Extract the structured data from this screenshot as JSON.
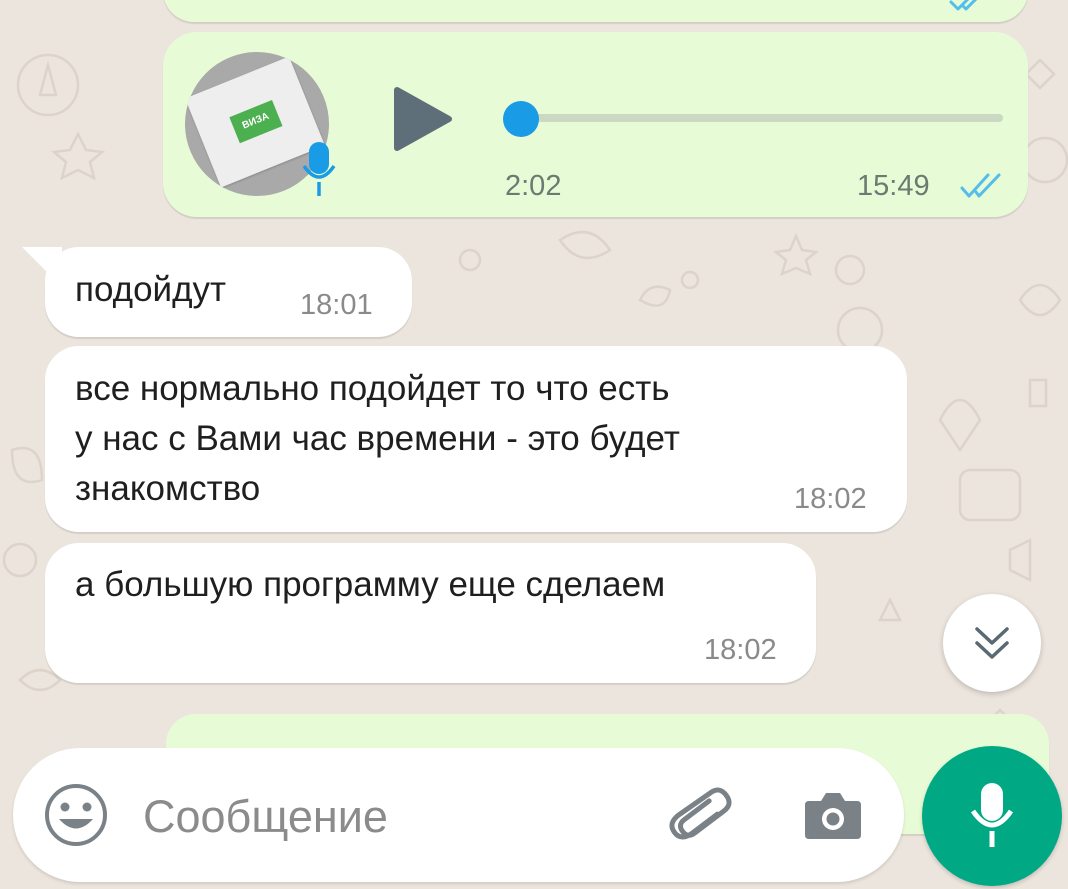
{
  "voice_message": {
    "duration": "2:02",
    "time": "15:49",
    "status_icon": "double-check-icon",
    "status_color": "#53bdeb",
    "avatar_badge_text": "ВИЗА"
  },
  "messages": [
    {
      "text": "подойдут",
      "time": "18:01"
    },
    {
      "text": "все нормально подойдет то что есть\nу нас с Вами час времени - это будет\nзнакомство",
      "time": "18:02"
    },
    {
      "text": "а большую программу еще сделаем",
      "time": "18:02"
    }
  ],
  "composer": {
    "placeholder": "Сообщение",
    "emoji_icon": "emoji-icon",
    "attach_icon": "paperclip-icon",
    "camera_icon": "camera-icon",
    "send_icon": "mic-icon"
  },
  "colors": {
    "outgoing_bubble": "#e7fcd6",
    "incoming_bubble": "#ffffff",
    "accent": "#00a884",
    "read_ticks": "#53bdeb",
    "playback_dot": "#1a9be6"
  }
}
